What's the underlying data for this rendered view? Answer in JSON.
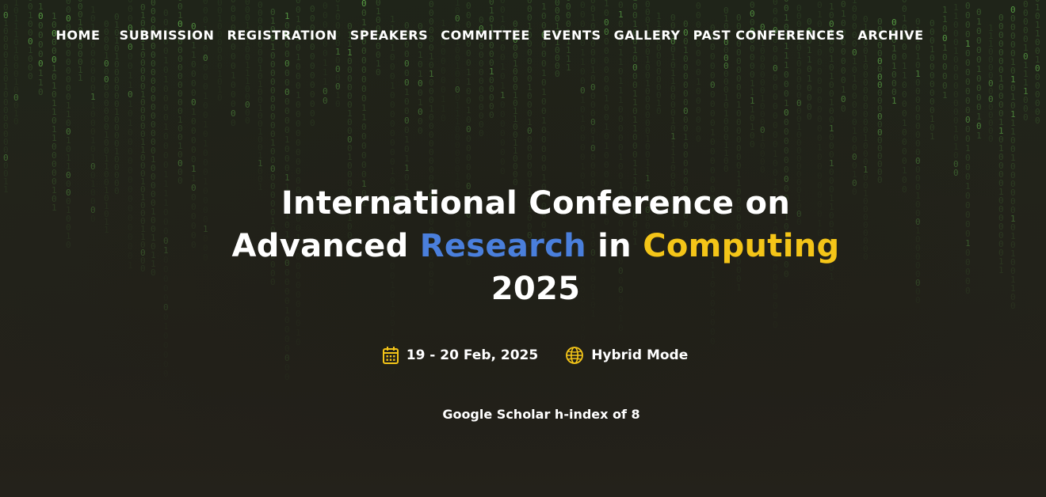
{
  "nav": {
    "items": [
      {
        "label": "HOME"
      },
      {
        "label": "SUBMISSION"
      },
      {
        "label": "REGISTRATION"
      },
      {
        "label": "SPEAKERS"
      },
      {
        "label": "COMMITTEE"
      },
      {
        "label": "EVENTS"
      },
      {
        "label": "GALLERY"
      },
      {
        "label": "PAST CONFERENCES"
      },
      {
        "label": "ARCHIVE"
      }
    ]
  },
  "hero": {
    "title_line1": "International Conference on",
    "title_line2_a": "Advanced ",
    "title_line2_b": "Research",
    "title_line2_c": " in ",
    "title_line2_d": "Computing",
    "title_line3": "2025",
    "date": "19 - 20 Feb, 2025",
    "mode": "Hybrid Mode",
    "h_index": "Google Scholar h-index of 8",
    "icons": {
      "date_icon": "calendar-icon",
      "mode_icon": "globe-icon"
    }
  },
  "colors": {
    "accent_blue": "#4a7fdc",
    "accent_yellow": "#f4c518",
    "background": "#23211a",
    "rain_green": "#5fae4a"
  }
}
